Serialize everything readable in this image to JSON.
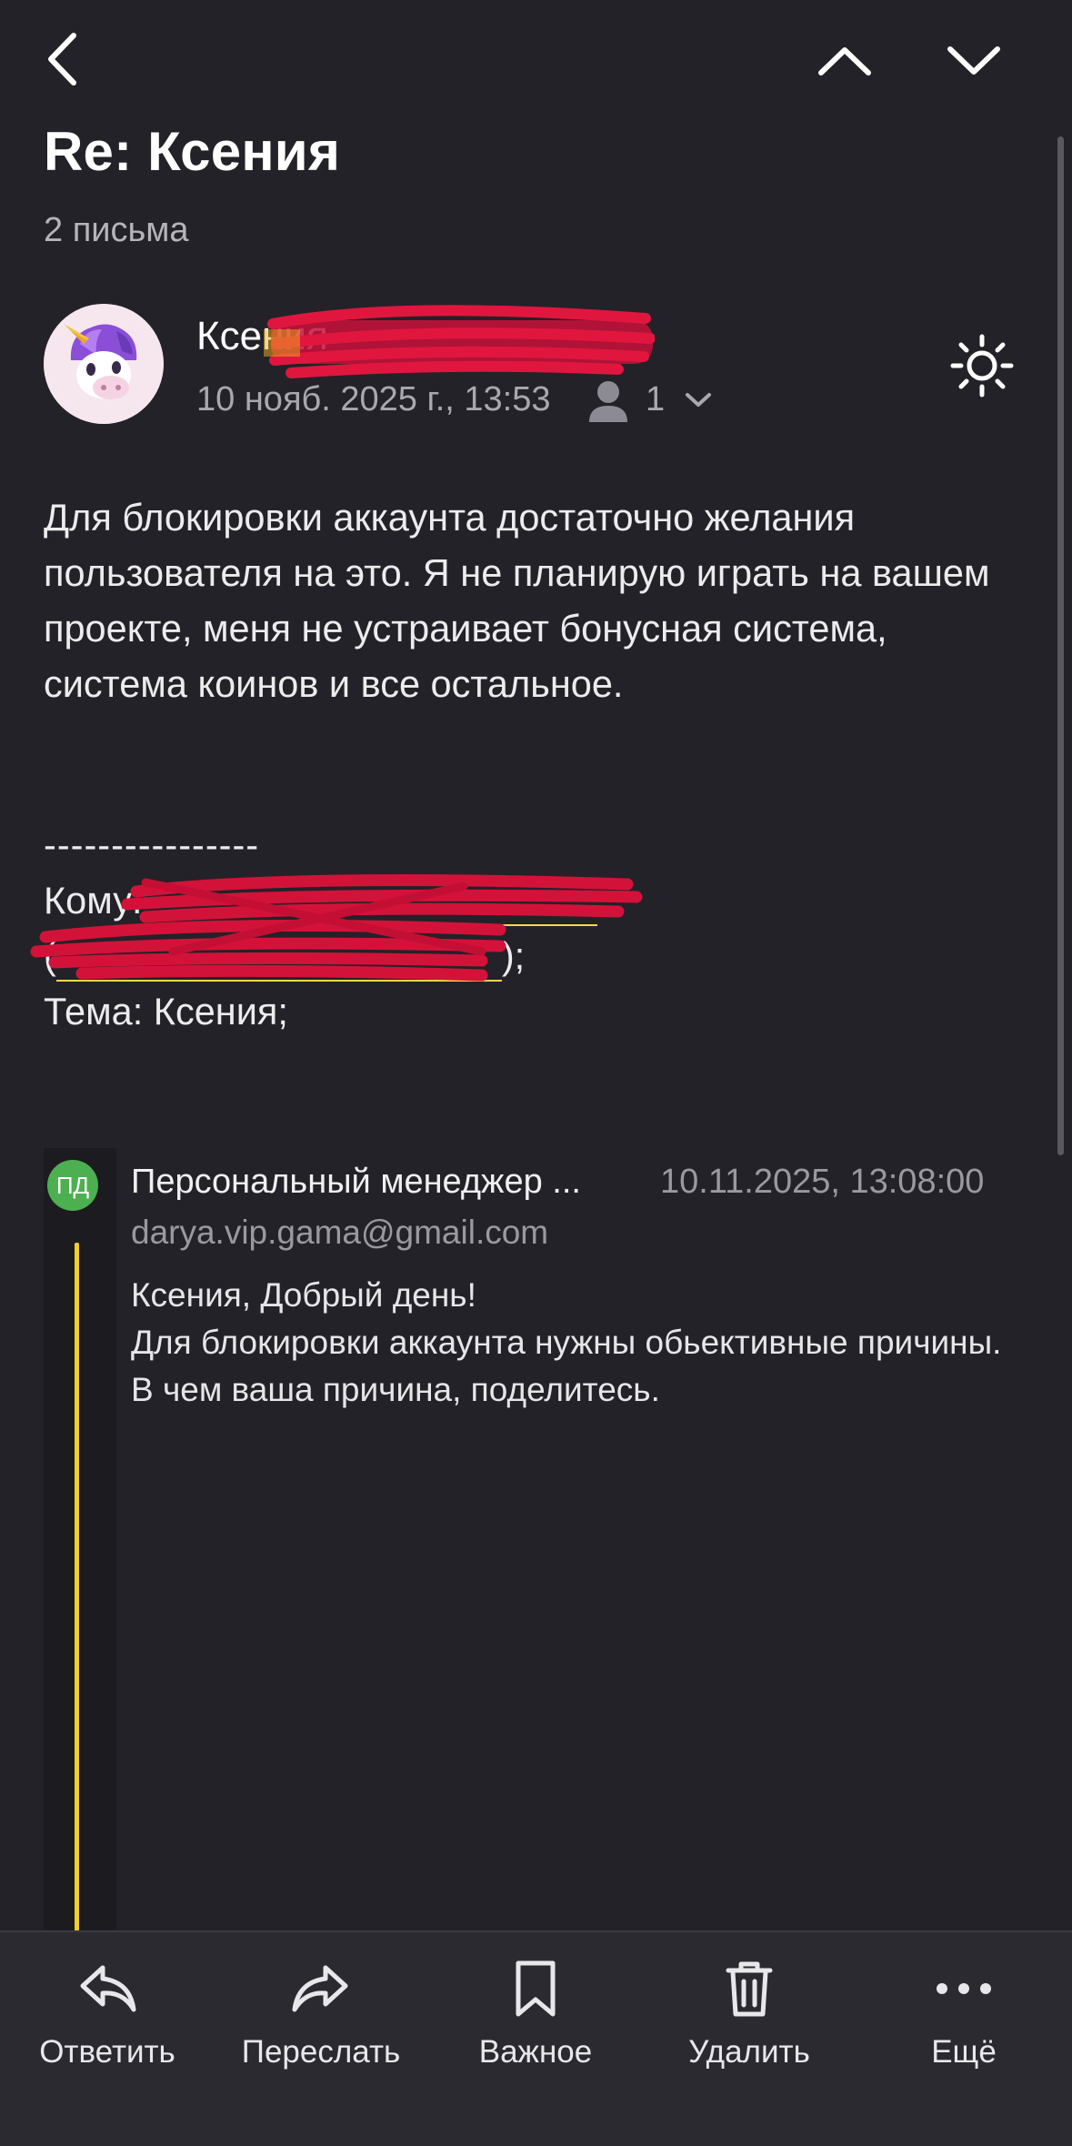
{
  "header": {
    "subject": "Re: Ксения",
    "message_count": "2 письма"
  },
  "message": {
    "sender_name": "Ксения",
    "date": "10 нояб. 2025 г., 13:53",
    "recipients_count": "1",
    "body": "Для блокировки аккаунта достаточно желания пользователя на это. Я не планирую играть на вашем проекте, меня не устраивает бонусная система, система коинов и все остальное.",
    "separator": "----------------",
    "to_label": "Кому: ",
    "to_close": ");",
    "to_open": "(",
    "subject_line": "Тема: Ксения;"
  },
  "quoted": {
    "avatar_initials": "ПД",
    "sender": "Персональный менеджер ...",
    "date": "10.11.2025, 13:08:00",
    "email": "darya.vip.gama@gmail.com",
    "lines": [
      "Ксения, Добрый день!",
      "Для блокировки аккаунта нужны обьективные причины.",
      "В чем ваша причина, поделитесь."
    ]
  },
  "toolbar": {
    "reply": "Ответить",
    "forward": "Переслать",
    "important": "Важное",
    "delete": "Удалить",
    "more": "Ещё"
  },
  "colors": {
    "background": "#232228",
    "link": "#f4d94a",
    "quote_bar": "#f2cd2f",
    "avatar_green": "#4caf50",
    "redaction": "#d3123a"
  }
}
